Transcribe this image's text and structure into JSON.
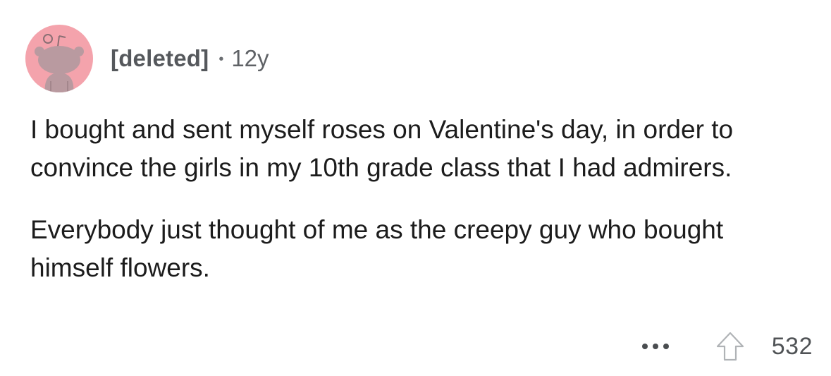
{
  "comment": {
    "author": "[deleted]",
    "separator": "•",
    "age": "12y",
    "paragraphs": [
      "I bought and sent myself roses on Valentine's day, in order to convince the girls in my 10th grade class that I had admirers.",
      "Everybody just thought of me as the creepy guy who bought himself flowers."
    ],
    "score": "532"
  },
  "icons": {
    "avatar": "snoo-avatar",
    "more": "more-dots-icon",
    "upvote": "upvote-arrow-icon"
  },
  "colors": {
    "avatar_background": "#f4a3ac",
    "avatar_figure": "#b99aa0",
    "meta_text": "#5f6266",
    "body_text": "#1c1c1c"
  }
}
